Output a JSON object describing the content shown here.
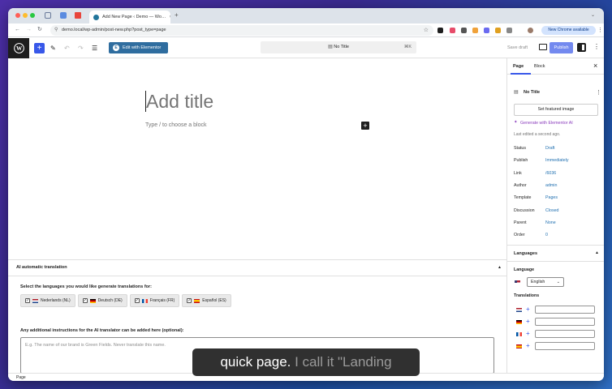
{
  "browser": {
    "tab_title": "Add New Page ‹ Demo — Wo…",
    "new_tab_symbol": "+",
    "url": "demo.local/wp-admin/post-new.php?post_type=page",
    "new_chrome_label": "New Chrome available",
    "menu_symbol": "⋮"
  },
  "toolbar": {
    "add_symbol": "+",
    "edit_elementor_label": "Edit with Elementor",
    "document_title": "No Title",
    "shortcut": "⌘K",
    "save_draft_label": "Save draft",
    "publish_label": "Publish"
  },
  "editor": {
    "title_placeholder": "Add title",
    "block_placeholder": "Type / to choose a block",
    "add_block_symbol": "+"
  },
  "ai_box": {
    "heading": "AI automatic translation",
    "collapse_symbol": "▲",
    "languages_prompt": "Select the languages you would like generate translations for:",
    "options": [
      {
        "label": "Nederlands (NL)",
        "check": "✓"
      },
      {
        "label": "Deutsch (DE)",
        "check": "✓"
      },
      {
        "label": "Français (FR)",
        "check": "✓"
      },
      {
        "label": "Español (ES)",
        "check": "✓"
      }
    ],
    "instructions_label": "Any additional instructions for the AI translator can be added here (optional):",
    "instructions_placeholder": "E.g. The name of our brand is Green Fields. Never translate this name."
  },
  "sidebar": {
    "tab_page": "Page",
    "tab_block": "Block",
    "close_symbol": "×",
    "page_title": "No Title",
    "featured_image_label": "Set featured image",
    "generate_ai_label": "Generate with Elementor AI",
    "last_edited": "Last edited a second ago.",
    "settings": [
      {
        "label": "Status",
        "value": "Draft"
      },
      {
        "label": "Publish",
        "value": "Immediately"
      },
      {
        "label": "Link",
        "value": "/6036"
      },
      {
        "label": "Author",
        "value": "admin"
      },
      {
        "label": "Template",
        "value": "Pages"
      },
      {
        "label": "Discussion",
        "value": "Closed"
      },
      {
        "label": "Parent",
        "value": "None"
      },
      {
        "label": "Order",
        "value": "0"
      }
    ],
    "languages_heading": "Languages",
    "language_label": "Language",
    "language_value": "English",
    "translations_label": "Translations",
    "add_symbol": "+"
  },
  "status_bar": {
    "breadcrumb": "Page"
  },
  "caption": {
    "spoken": "quick page.",
    "upcoming": " I call it \"Landing"
  },
  "colors": {
    "accent": "#3858e9",
    "link": "#2271b1",
    "elementor": "#2f6d9f"
  }
}
